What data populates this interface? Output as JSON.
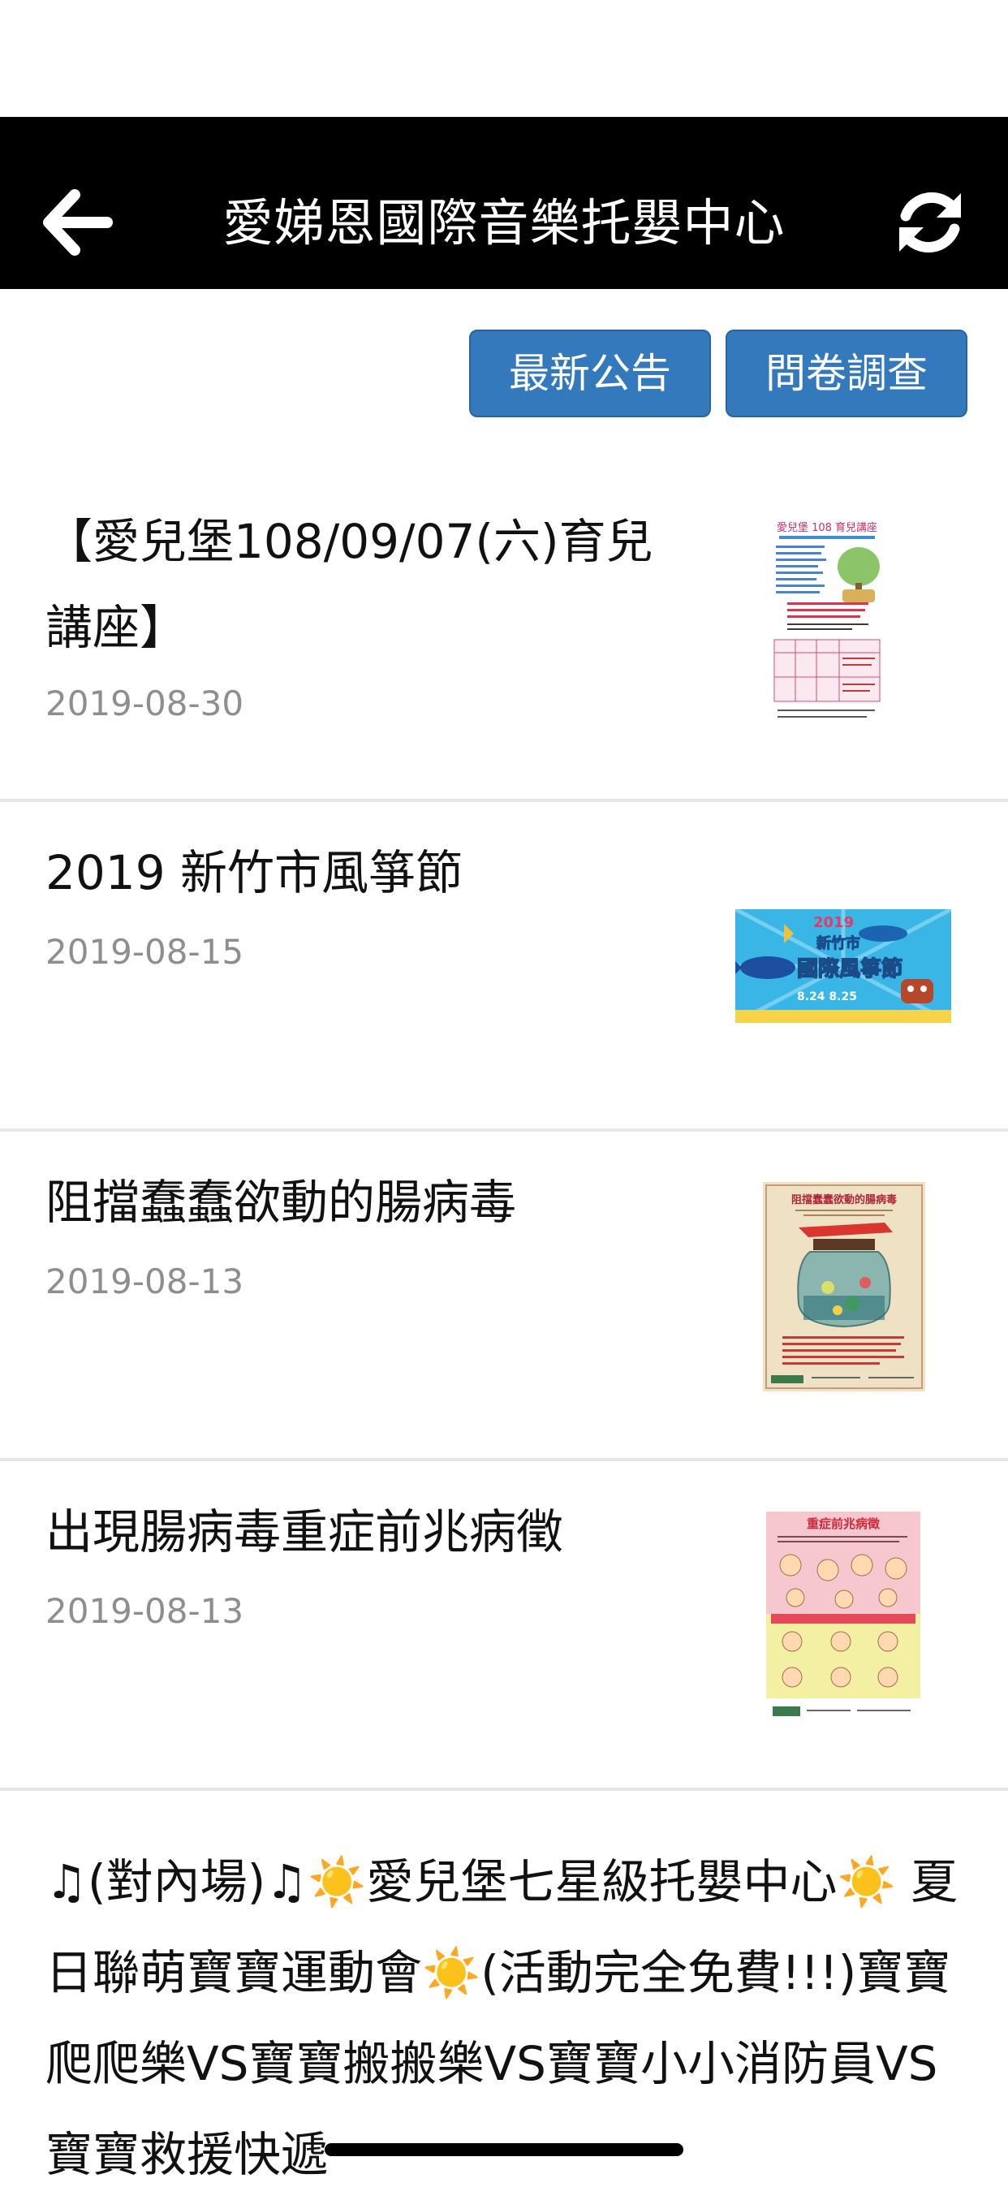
{
  "header": {
    "title": "愛娣恩國際音樂托嬰中心",
    "back_icon": "arrow-left-icon",
    "refresh_icon": "refresh-icon"
  },
  "actions": {
    "news_label": "最新公告",
    "survey_label": "問卷調查",
    "button_color": "#3579bd"
  },
  "posts": [
    {
      "title": "【愛兒堡108/09/07(六)育兒講座】",
      "date": "2019-08-30",
      "thumb": "lecture-flyer-thumbnail"
    },
    {
      "title": "2019 新竹市風箏節",
      "date": "2019-08-15",
      "thumb": "kite-festival-thumbnail"
    },
    {
      "title": "阻擋蠢蠢欲動的腸病毒",
      "date": "2019-08-13",
      "thumb": "enterovirus-poster-thumbnail"
    },
    {
      "title": "出現腸病毒重症前兆病徵",
      "date": "2019-08-13",
      "thumb": "enterovirus-symptoms-thumbnail"
    },
    {
      "title": "♫(對內場)♫☀️愛兒堡七星級托嬰中心☀️ 夏日聯萌寶寶運動會☀️(活動完全免費!!!)寶寶爬爬樂VS寶寶搬搬樂VS寶寶小小消防員VS寶寶救援快遞"
    }
  ],
  "thumb_texts": {
    "lecture": "愛兒堡 108 育兒講座",
    "kite_year": "2019",
    "kite_city": "新竹市",
    "kite_name": "國際風箏節",
    "kite_dates": "8.24  8.25",
    "virus": "阻擋蠢蠢欲動的腸病毒",
    "symptoms": "重症前兆病徵"
  }
}
